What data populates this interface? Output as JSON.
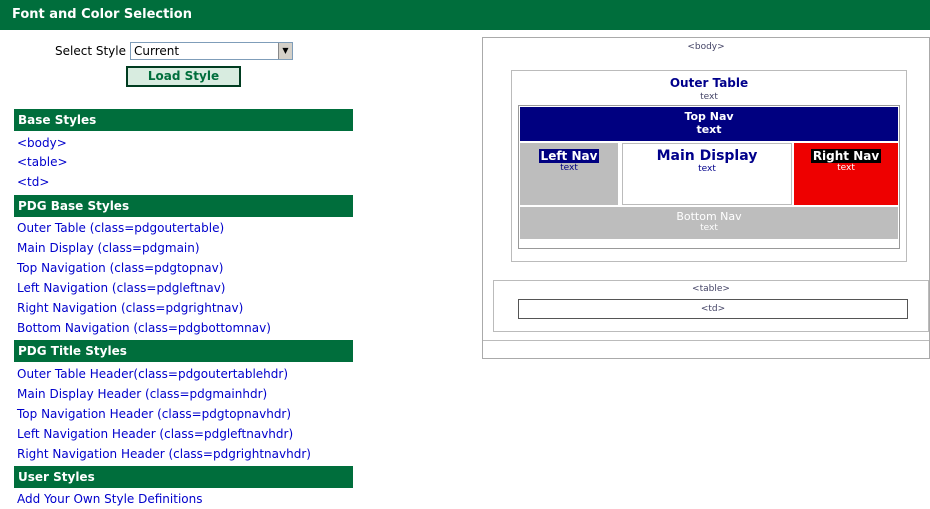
{
  "header": {
    "title": "Font and Color Selection"
  },
  "style_select": {
    "label": "Select Style",
    "value": "Current",
    "button": "Load Style"
  },
  "sections": {
    "base": "Base Styles",
    "pdg_base": "PDG Base Styles",
    "pdg_title": "PDG Title Styles",
    "user": "User Styles"
  },
  "base_links": [
    "<body>",
    "<table>",
    "<td>"
  ],
  "pdg_base_links": [
    "Outer Table (class=pdgoutertable)",
    "Main Display (class=pdgmain)",
    "Top Navigation (class=pdgtopnav)",
    "Left Navigation (class=pdgleftnav)",
    "Right Navigation (class=pdgrightnav)",
    "Bottom Navigation (class=pdgbottomnav)"
  ],
  "pdg_title_links": [
    "Outer Table Header(class=pdgoutertablehdr)",
    "Main Display Header (class=pdgmainhdr)",
    "Top Navigation Header (class=pdgtopnavhdr)",
    "Left Navigation Header (class=pdgleftnavhdr)",
    "Right Navigation Header (class=pdgrightnavhdr)"
  ],
  "user_links": [
    "Add Your Own Style Definitions"
  ],
  "preview": {
    "body_tag": "<body>",
    "outer_title": "Outer Table",
    "outer_text": "text",
    "top_nav": "Top Nav",
    "top_text": "text",
    "left_nav": "Left Nav",
    "left_text": "text",
    "main_title": "Main Display",
    "main_text": "text",
    "right_nav": "Right Nav",
    "right_text": "text",
    "bottom_nav": "Bottom Nav",
    "bottom_text": "text",
    "table_tag": "<table>",
    "td_tag": "<td>"
  },
  "colors": {
    "header_green": "#006e3c",
    "top_nav": "#000080",
    "right_nav": "#ee0000",
    "left_nav": "#bdbdbd"
  }
}
